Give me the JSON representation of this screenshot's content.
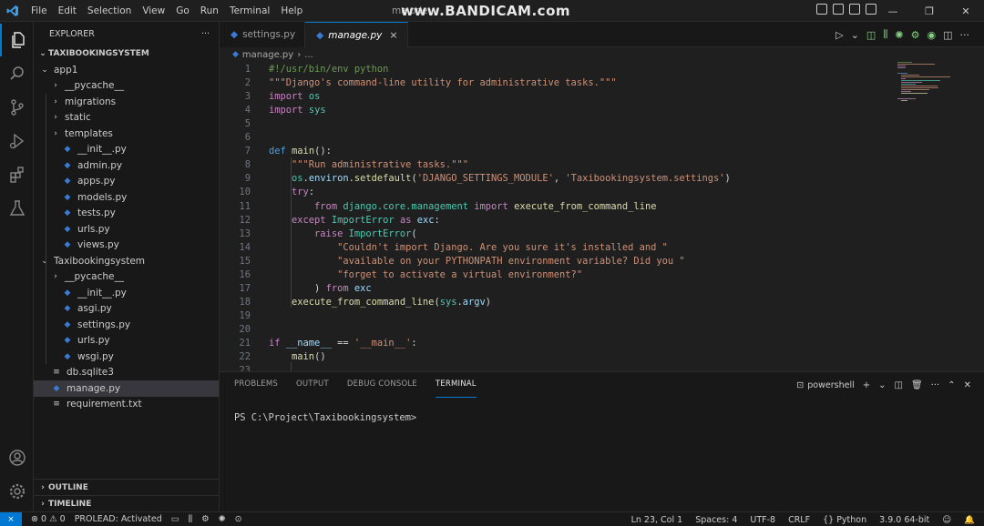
{
  "titlebar": {
    "menu": [
      "File",
      "Edit",
      "Selection",
      "View",
      "Go",
      "Run",
      "Terminal",
      "Help"
    ],
    "window_title": "ma                                              ode",
    "watermark": "www.BANDICAM.com",
    "controls": {
      "minimize": "—",
      "restore": "❐",
      "close": "✕"
    }
  },
  "activitybar": {
    "items": [
      "explorer-icon",
      "search-icon",
      "source-control-icon",
      "run-debug-icon",
      "extensions-icon",
      "testing-icon"
    ],
    "bottom": [
      "account-icon",
      "settings-gear-icon"
    ]
  },
  "sidebar": {
    "header": "EXPLORER",
    "more": "···",
    "project": "TAXIBOOKINGSYSTEM",
    "tree": [
      {
        "label": "app1",
        "type": "folder",
        "open": true,
        "depth": 1
      },
      {
        "label": "__pycache__",
        "type": "folder",
        "open": false,
        "depth": 2
      },
      {
        "label": "migrations",
        "type": "folder",
        "open": false,
        "depth": 2
      },
      {
        "label": "static",
        "type": "folder",
        "open": false,
        "depth": 2
      },
      {
        "label": "templates",
        "type": "folder",
        "open": false,
        "depth": 2
      },
      {
        "label": "__init__.py",
        "type": "py",
        "depth": 2
      },
      {
        "label": "admin.py",
        "type": "py",
        "depth": 2
      },
      {
        "label": "apps.py",
        "type": "py",
        "depth": 2
      },
      {
        "label": "models.py",
        "type": "py",
        "depth": 2
      },
      {
        "label": "tests.py",
        "type": "py",
        "depth": 2
      },
      {
        "label": "urls.py",
        "type": "py",
        "depth": 2
      },
      {
        "label": "views.py",
        "type": "py",
        "depth": 2
      },
      {
        "label": "Taxibookingsystem",
        "type": "folder",
        "open": true,
        "depth": 1
      },
      {
        "label": "__pycache__",
        "type": "folder",
        "open": false,
        "depth": 2
      },
      {
        "label": "__init__.py",
        "type": "py",
        "depth": 2
      },
      {
        "label": "asgi.py",
        "type": "py",
        "depth": 2
      },
      {
        "label": "settings.py",
        "type": "py",
        "depth": 2
      },
      {
        "label": "urls.py",
        "type": "py",
        "depth": 2
      },
      {
        "label": "wsgi.py",
        "type": "py",
        "depth": 2
      },
      {
        "label": "db.sqlite3",
        "type": "db",
        "depth": 1
      },
      {
        "label": "manage.py",
        "type": "py",
        "depth": 1,
        "selected": true
      },
      {
        "label": "requirement.txt",
        "type": "txt",
        "depth": 1
      }
    ],
    "outline": "OUTLINE",
    "timeline": "TIMELINE"
  },
  "tabs": [
    {
      "label": "settings.py",
      "active": false
    },
    {
      "label": "manage.py",
      "active": true,
      "close": "×"
    }
  ],
  "breadcrumb": {
    "file": "manage.py",
    "sep": "›",
    "rest": "..."
  },
  "code_lines": [
    {
      "n": "1",
      "t": [
        [
          "cmt",
          "#!/usr/bin/env python"
        ]
      ]
    },
    {
      "n": "2",
      "t": [
        [
          "str",
          "\"\"\"Django's command-line utility for administrative tasks.\"\"\""
        ]
      ]
    },
    {
      "n": "3",
      "t": [
        [
          "kw2",
          "import"
        ],
        [
          "pl",
          " "
        ],
        [
          "cls",
          "os"
        ]
      ]
    },
    {
      "n": "4",
      "t": [
        [
          "kw2",
          "import"
        ],
        [
          "pl",
          " "
        ],
        [
          "cls",
          "sys"
        ]
      ]
    },
    {
      "n": "5",
      "t": []
    },
    {
      "n": "6",
      "t": []
    },
    {
      "n": "7",
      "t": [
        [
          "kw",
          "def"
        ],
        [
          "pl",
          " "
        ],
        [
          "fn",
          "main"
        ],
        [
          "pl",
          "():"
        ]
      ]
    },
    {
      "n": "8",
      "t": [
        [
          "pl",
          "    "
        ],
        [
          "str",
          "\"\"\"Run administrative tasks.\"\"\""
        ]
      ]
    },
    {
      "n": "9",
      "t": [
        [
          "pl",
          "    "
        ],
        [
          "cls",
          "os"
        ],
        [
          "pl",
          "."
        ],
        [
          "var",
          "environ"
        ],
        [
          "pl",
          "."
        ],
        [
          "fn",
          "setdefault"
        ],
        [
          "pl",
          "("
        ],
        [
          "str",
          "'DJANGO_SETTINGS_MODULE'"
        ],
        [
          "pl",
          ", "
        ],
        [
          "str",
          "'Taxibookingsystem.settings'"
        ],
        [
          "pl",
          ")"
        ]
      ]
    },
    {
      "n": "10",
      "t": [
        [
          "pl",
          "    "
        ],
        [
          "kw2",
          "try"
        ],
        [
          "pl",
          ":"
        ]
      ]
    },
    {
      "n": "11",
      "t": [
        [
          "pl",
          "        "
        ],
        [
          "kw2",
          "from"
        ],
        [
          "pl",
          " "
        ],
        [
          "cls",
          "django.core.management"
        ],
        [
          "pl",
          " "
        ],
        [
          "kw2",
          "import"
        ],
        [
          "pl",
          " "
        ],
        [
          "fn",
          "execute_from_command_line"
        ]
      ]
    },
    {
      "n": "12",
      "t": [
        [
          "pl",
          "    "
        ],
        [
          "kw2",
          "except"
        ],
        [
          "pl",
          " "
        ],
        [
          "cls",
          "ImportError"
        ],
        [
          "pl",
          " "
        ],
        [
          "kw2",
          "as"
        ],
        [
          "pl",
          " "
        ],
        [
          "var",
          "exc"
        ],
        [
          "pl",
          ":"
        ]
      ]
    },
    {
      "n": "13",
      "t": [
        [
          "pl",
          "        "
        ],
        [
          "kw2",
          "raise"
        ],
        [
          "pl",
          " "
        ],
        [
          "cls",
          "ImportError"
        ],
        [
          "pl",
          "("
        ]
      ]
    },
    {
      "n": "14",
      "t": [
        [
          "pl",
          "            "
        ],
        [
          "str",
          "\"Couldn't import Django. Are you sure it's installed and \""
        ]
      ]
    },
    {
      "n": "15",
      "t": [
        [
          "pl",
          "            "
        ],
        [
          "str",
          "\"available on your PYTHONPATH environment variable? Did you \""
        ]
      ]
    },
    {
      "n": "16",
      "t": [
        [
          "pl",
          "            "
        ],
        [
          "str",
          "\"forget to activate a virtual environment?\""
        ]
      ]
    },
    {
      "n": "17",
      "t": [
        [
          "pl",
          "        ) "
        ],
        [
          "kw2",
          "from"
        ],
        [
          "pl",
          " "
        ],
        [
          "var",
          "exc"
        ]
      ]
    },
    {
      "n": "18",
      "t": [
        [
          "pl",
          "    "
        ],
        [
          "fn",
          "execute_from_command_line"
        ],
        [
          "pl",
          "("
        ],
        [
          "cls",
          "sys"
        ],
        [
          "pl",
          "."
        ],
        [
          "var",
          "argv"
        ],
        [
          "pl",
          ")"
        ]
      ]
    },
    {
      "n": "19",
      "t": []
    },
    {
      "n": "20",
      "t": []
    },
    {
      "n": "21",
      "t": [
        [
          "kw2",
          "if"
        ],
        [
          "pl",
          " "
        ],
        [
          "var",
          "__name__"
        ],
        [
          "pl",
          " == "
        ],
        [
          "str",
          "'__main__'"
        ],
        [
          "pl",
          ":"
        ]
      ]
    },
    {
      "n": "22",
      "t": [
        [
          "pl",
          "    "
        ],
        [
          "fn",
          "main"
        ],
        [
          "pl",
          "()"
        ]
      ]
    },
    {
      "n": "23",
      "t": []
    }
  ],
  "panel": {
    "tabs": [
      {
        "label": "PROBLEMS",
        "active": false
      },
      {
        "label": "OUTPUT",
        "active": false
      },
      {
        "label": "DEBUG CONSOLE",
        "active": false
      },
      {
        "label": "TERMINAL",
        "active": true
      }
    ],
    "shell": "powershell",
    "plus": "+",
    "caret": "⌄",
    "more": "···",
    "maximize": "⌃",
    "close": "✕",
    "prompt": "PS C:\\Project\\Taxibookingsystem> "
  },
  "statusbar": {
    "remote": "⨯",
    "errors": "0",
    "warnings": "0",
    "prolead": "PROLEAD: Activated",
    "position": "Ln 23, Col 1",
    "spaces": "Spaces: 4",
    "encoding": "UTF-8",
    "eol": "CRLF",
    "language": "Python",
    "interpreter": "3.9.0 64-bit"
  },
  "colors": {
    "accent": "#0078d4",
    "python_icon": "#3a7bd5",
    "run_green": "#89d185"
  }
}
